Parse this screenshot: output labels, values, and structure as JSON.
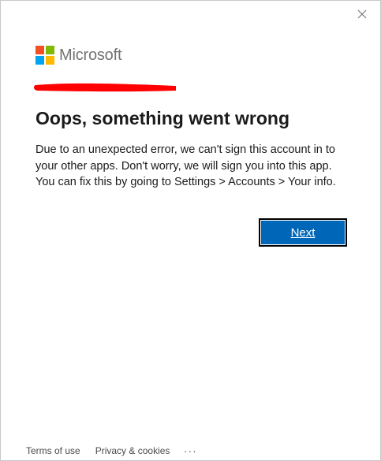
{
  "window": {
    "close_icon": "close-icon"
  },
  "brand": {
    "name": "Microsoft",
    "logo_colors": [
      "#f25022",
      "#7fba00",
      "#00a4ef",
      "#ffb900"
    ]
  },
  "redaction": {
    "color": "#ff0000"
  },
  "dialog": {
    "title": "Oops, something went wrong",
    "message": "Due to an unexpected error, we can't sign this account in to your other apps. Don't worry, we will sign you into this app. You can fix this by going to Settings > Accounts > Your info.",
    "next_label": "Next",
    "accent_color": "#0067b8"
  },
  "footer": {
    "terms_label": "Terms of use",
    "privacy_label": "Privacy & cookies",
    "more_label": "..."
  }
}
